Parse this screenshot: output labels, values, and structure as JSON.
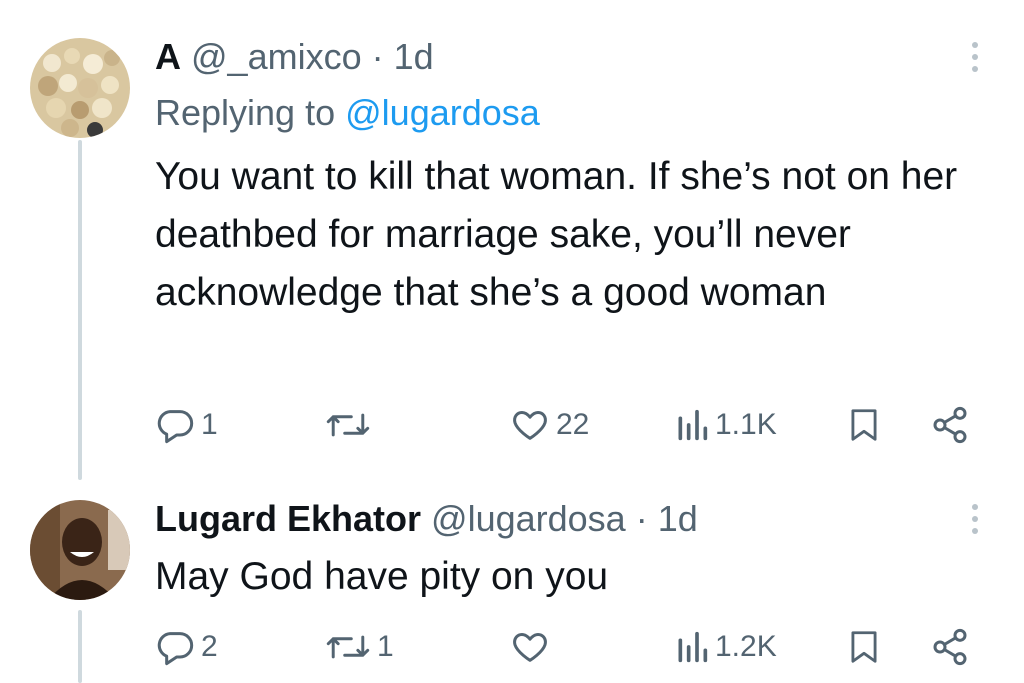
{
  "tweets": [
    {
      "display_name": "A",
      "handle": "@_amixco",
      "separator": "·",
      "time": "1d",
      "replying_prefix": "Replying to",
      "replying_to": "@lugardosa",
      "text": "You want to kill that woman. If she’s not on her deathbed for marriage sake, you’ll never acknowledge that she’s a good woman",
      "replies": "1",
      "retweets": "",
      "likes": "22",
      "views": "1.1K"
    },
    {
      "display_name": "Lugard Ekhator",
      "handle": "@lugardosa",
      "separator": "·",
      "time": "1d",
      "text": "May God have pity on you",
      "replies": "2",
      "retweets": "1",
      "likes": "",
      "views": "1.2K"
    }
  ],
  "icons": {
    "reply": "reply-icon",
    "retweet": "retweet-icon",
    "like": "heart-icon",
    "views": "views-icon",
    "bookmark": "bookmark-icon",
    "share": "share-icon",
    "more": "more-vertical-icon"
  },
  "colors": {
    "text": "#0f1419",
    "secondary": "#536471",
    "link": "#1d9bf0",
    "thread_line": "#cfd9de"
  }
}
